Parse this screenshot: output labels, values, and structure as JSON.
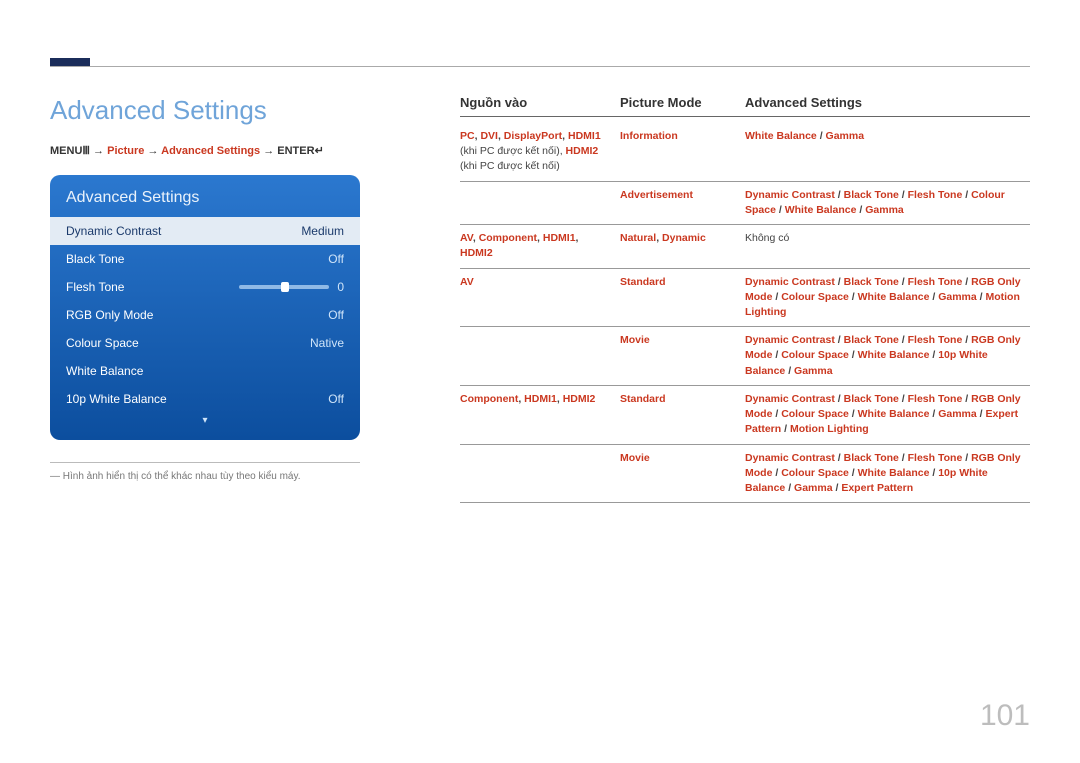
{
  "title": "Advanced Settings",
  "breadcrumb": {
    "menu": "MENU",
    "menu_icon": "Ⅲ",
    "arrow": " → ",
    "picture": "Picture",
    "adv": "Advanced Settings",
    "enter": "ENTER",
    "enter_icon": "↵"
  },
  "osd": {
    "title": "Advanced Settings",
    "rows": [
      {
        "label": "Dynamic Contrast",
        "value": "Medium",
        "selected": true,
        "slider": false
      },
      {
        "label": "Black Tone",
        "value": "Off",
        "selected": false,
        "slider": false
      },
      {
        "label": "Flesh Tone",
        "value": "0",
        "selected": false,
        "slider": true
      },
      {
        "label": "RGB Only Mode",
        "value": "Off",
        "selected": false,
        "slider": false
      },
      {
        "label": "Colour Space",
        "value": "Native",
        "selected": false,
        "slider": false
      },
      {
        "label": "White Balance",
        "value": "",
        "selected": false,
        "slider": false
      },
      {
        "label": "10p White Balance",
        "value": "Off",
        "selected": false,
        "slider": false
      }
    ]
  },
  "footnote": "―  Hình ảnh hiển thị có thể khác nhau tùy theo kiểu máy.",
  "table": {
    "headers": {
      "c1": "Nguồn vào",
      "c2": "Picture Mode",
      "c3": "Advanced Settings"
    },
    "rows": [
      {
        "c1": [
          {
            "t": "PC",
            "hl": 1
          },
          {
            "t": ", "
          },
          {
            "t": "DVI",
            "hl": 1
          },
          {
            "t": ", "
          },
          {
            "t": "DisplayPort",
            "hl": 1
          },
          {
            "t": ", "
          },
          {
            "t": "HDMI1",
            "hl": 1
          },
          {
            "t": " (khi PC được kết nối), ",
            "plain": 1
          },
          {
            "t": "HDMI2",
            "hl": 1
          },
          {
            "t": " (khi PC được kết nối)",
            "plain": 1
          }
        ],
        "c2": [
          {
            "t": "Information",
            "hl": 1
          }
        ],
        "c3": [
          {
            "t": "White Balance",
            "hl": 1
          },
          {
            "t": " / "
          },
          {
            "t": "Gamma",
            "hl": 1
          }
        ]
      },
      {
        "c1": [],
        "c2": [
          {
            "t": "Advertisement",
            "hl": 1
          }
        ],
        "c3": [
          {
            "t": "Dynamic Contrast",
            "hl": 1
          },
          {
            "t": " / "
          },
          {
            "t": "Black Tone",
            "hl": 1
          },
          {
            "t": " / "
          },
          {
            "t": "Flesh Tone",
            "hl": 1
          },
          {
            "t": " / "
          },
          {
            "t": "Colour Space",
            "hl": 1
          },
          {
            "t": " / "
          },
          {
            "t": "White Balance",
            "hl": 1
          },
          {
            "t": " / "
          },
          {
            "t": "Gamma",
            "hl": 1
          }
        ]
      },
      {
        "c1": [
          {
            "t": "AV",
            "hl": 1
          },
          {
            "t": ", "
          },
          {
            "t": "Component",
            "hl": 1
          },
          {
            "t": ", "
          },
          {
            "t": "HDMI1",
            "hl": 1
          },
          {
            "t": ", "
          },
          {
            "t": "HDMI2",
            "hl": 1
          }
        ],
        "c2": [
          {
            "t": "Natural",
            "hl": 1
          },
          {
            "t": ", "
          },
          {
            "t": "Dynamic",
            "hl": 1
          }
        ],
        "c3": [
          {
            "t": "Không có",
            "plain": 1
          }
        ]
      },
      {
        "c1": [
          {
            "t": "AV",
            "hl": 1
          }
        ],
        "c2": [
          {
            "t": "Standard",
            "hl": 1
          }
        ],
        "c3": [
          {
            "t": "Dynamic Contrast",
            "hl": 1
          },
          {
            "t": " / "
          },
          {
            "t": "Black Tone",
            "hl": 1
          },
          {
            "t": " / "
          },
          {
            "t": "Flesh Tone",
            "hl": 1
          },
          {
            "t": " / "
          },
          {
            "t": "RGB Only Mode",
            "hl": 1
          },
          {
            "t": " / "
          },
          {
            "t": "Colour Space",
            "hl": 1
          },
          {
            "t": " / "
          },
          {
            "t": "White Balance",
            "hl": 1
          },
          {
            "t": " / "
          },
          {
            "t": "Gamma",
            "hl": 1
          },
          {
            "t": " / "
          },
          {
            "t": "Motion Lighting",
            "hl": 1
          }
        ]
      },
      {
        "c1": [],
        "c2": [
          {
            "t": "Movie",
            "hl": 1
          }
        ],
        "c3": [
          {
            "t": "Dynamic Contrast",
            "hl": 1
          },
          {
            "t": " / "
          },
          {
            "t": "Black Tone",
            "hl": 1
          },
          {
            "t": " / "
          },
          {
            "t": "Flesh Tone",
            "hl": 1
          },
          {
            "t": " / "
          },
          {
            "t": "RGB Only Mode",
            "hl": 1
          },
          {
            "t": " / "
          },
          {
            "t": "Colour Space",
            "hl": 1
          },
          {
            "t": " / "
          },
          {
            "t": "White Balance",
            "hl": 1
          },
          {
            "t": " / "
          },
          {
            "t": "10p White Balance",
            "hl": 1
          },
          {
            "t": " / "
          },
          {
            "t": "Gamma",
            "hl": 1
          }
        ]
      },
      {
        "c1": [
          {
            "t": "Component",
            "hl": 1
          },
          {
            "t": ", "
          },
          {
            "t": "HDMI1",
            "hl": 1
          },
          {
            "t": ", "
          },
          {
            "t": "HDMI2",
            "hl": 1
          }
        ],
        "c2": [
          {
            "t": "Standard",
            "hl": 1
          }
        ],
        "c3": [
          {
            "t": "Dynamic Contrast",
            "hl": 1
          },
          {
            "t": " / "
          },
          {
            "t": "Black Tone",
            "hl": 1
          },
          {
            "t": " / "
          },
          {
            "t": "Flesh Tone",
            "hl": 1
          },
          {
            "t": " / "
          },
          {
            "t": "RGB Only Mode",
            "hl": 1
          },
          {
            "t": " / "
          },
          {
            "t": "Colour Space",
            "hl": 1
          },
          {
            "t": " / "
          },
          {
            "t": "White Balance",
            "hl": 1
          },
          {
            "t": " / "
          },
          {
            "t": "Gamma",
            "hl": 1
          },
          {
            "t": " / "
          },
          {
            "t": "Expert Pattern",
            "hl": 1
          },
          {
            "t": " / "
          },
          {
            "t": "Motion Lighting",
            "hl": 1
          }
        ]
      },
      {
        "c1": [],
        "c2": [
          {
            "t": "Movie",
            "hl": 1
          }
        ],
        "c3": [
          {
            "t": "Dynamic Contrast",
            "hl": 1
          },
          {
            "t": " / "
          },
          {
            "t": "Black Tone",
            "hl": 1
          },
          {
            "t": " / "
          },
          {
            "t": "Flesh Tone",
            "hl": 1
          },
          {
            "t": " / "
          },
          {
            "t": "RGB Only Mode",
            "hl": 1
          },
          {
            "t": " / "
          },
          {
            "t": "Colour Space",
            "hl": 1
          },
          {
            "t": " / "
          },
          {
            "t": "White Balance",
            "hl": 1
          },
          {
            "t": " / "
          },
          {
            "t": "10p White Balance",
            "hl": 1
          },
          {
            "t": " / "
          },
          {
            "t": "Gamma",
            "hl": 1
          },
          {
            "t": " / "
          },
          {
            "t": "Expert Pattern",
            "hl": 1
          }
        ]
      }
    ]
  },
  "pagenum": "101"
}
